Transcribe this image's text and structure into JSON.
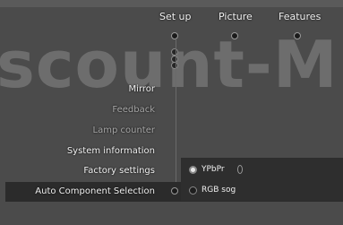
{
  "watermark": "scount-M",
  "tabs": [
    {
      "label": "Set up"
    },
    {
      "label": "Picture"
    },
    {
      "label": "Features"
    }
  ],
  "menu": {
    "items": [
      {
        "label": "Mirror",
        "enabled": true
      },
      {
        "label": "Feedback",
        "enabled": false
      },
      {
        "label": "Lamp counter",
        "enabled": false
      },
      {
        "label": "System information",
        "enabled": true
      },
      {
        "label": "Factory settings",
        "enabled": true
      },
      {
        "label": "Auto Component Selection",
        "enabled": true,
        "selected": true
      }
    ]
  },
  "submenu": {
    "options": [
      {
        "label": "YPbPr",
        "selected": true
      },
      {
        "label": "RGB sog",
        "selected": false
      }
    ]
  }
}
